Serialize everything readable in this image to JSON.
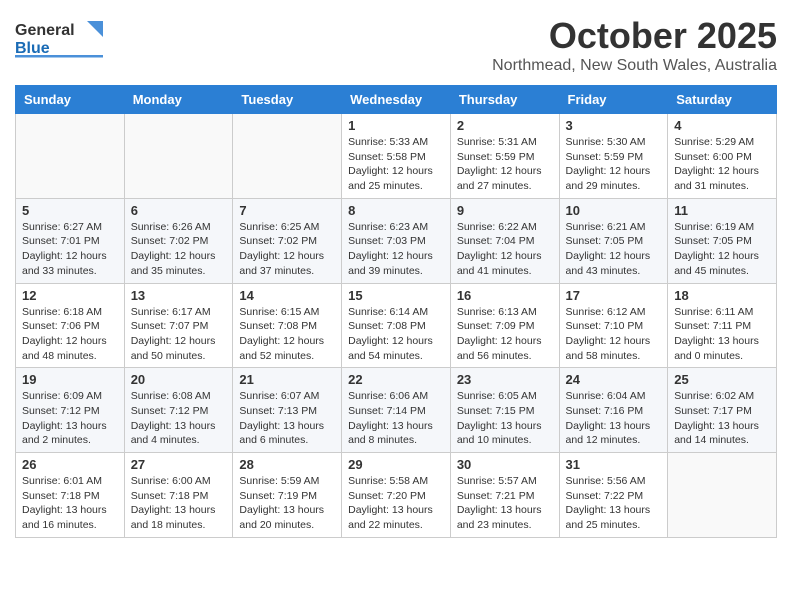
{
  "header": {
    "logo_general": "General",
    "logo_blue": "Blue",
    "month": "October 2025",
    "location": "Northmead, New South Wales, Australia"
  },
  "weekdays": [
    "Sunday",
    "Monday",
    "Tuesday",
    "Wednesday",
    "Thursday",
    "Friday",
    "Saturday"
  ],
  "weeks": [
    [
      {
        "day": "",
        "sunrise": "",
        "sunset": "",
        "daylight": ""
      },
      {
        "day": "",
        "sunrise": "",
        "sunset": "",
        "daylight": ""
      },
      {
        "day": "",
        "sunrise": "",
        "sunset": "",
        "daylight": ""
      },
      {
        "day": "1",
        "sunrise": "Sunrise: 5:33 AM",
        "sunset": "Sunset: 5:58 PM",
        "daylight": "Daylight: 12 hours and 25 minutes."
      },
      {
        "day": "2",
        "sunrise": "Sunrise: 5:31 AM",
        "sunset": "Sunset: 5:59 PM",
        "daylight": "Daylight: 12 hours and 27 minutes."
      },
      {
        "day": "3",
        "sunrise": "Sunrise: 5:30 AM",
        "sunset": "Sunset: 5:59 PM",
        "daylight": "Daylight: 12 hours and 29 minutes."
      },
      {
        "day": "4",
        "sunrise": "Sunrise: 5:29 AM",
        "sunset": "Sunset: 6:00 PM",
        "daylight": "Daylight: 12 hours and 31 minutes."
      }
    ],
    [
      {
        "day": "5",
        "sunrise": "Sunrise: 6:27 AM",
        "sunset": "Sunset: 7:01 PM",
        "daylight": "Daylight: 12 hours and 33 minutes."
      },
      {
        "day": "6",
        "sunrise": "Sunrise: 6:26 AM",
        "sunset": "Sunset: 7:02 PM",
        "daylight": "Daylight: 12 hours and 35 minutes."
      },
      {
        "day": "7",
        "sunrise": "Sunrise: 6:25 AM",
        "sunset": "Sunset: 7:02 PM",
        "daylight": "Daylight: 12 hours and 37 minutes."
      },
      {
        "day": "8",
        "sunrise": "Sunrise: 6:23 AM",
        "sunset": "Sunset: 7:03 PM",
        "daylight": "Daylight: 12 hours and 39 minutes."
      },
      {
        "day": "9",
        "sunrise": "Sunrise: 6:22 AM",
        "sunset": "Sunset: 7:04 PM",
        "daylight": "Daylight: 12 hours and 41 minutes."
      },
      {
        "day": "10",
        "sunrise": "Sunrise: 6:21 AM",
        "sunset": "Sunset: 7:05 PM",
        "daylight": "Daylight: 12 hours and 43 minutes."
      },
      {
        "day": "11",
        "sunrise": "Sunrise: 6:19 AM",
        "sunset": "Sunset: 7:05 PM",
        "daylight": "Daylight: 12 hours and 45 minutes."
      }
    ],
    [
      {
        "day": "12",
        "sunrise": "Sunrise: 6:18 AM",
        "sunset": "Sunset: 7:06 PM",
        "daylight": "Daylight: 12 hours and 48 minutes."
      },
      {
        "day": "13",
        "sunrise": "Sunrise: 6:17 AM",
        "sunset": "Sunset: 7:07 PM",
        "daylight": "Daylight: 12 hours and 50 minutes."
      },
      {
        "day": "14",
        "sunrise": "Sunrise: 6:15 AM",
        "sunset": "Sunset: 7:08 PM",
        "daylight": "Daylight: 12 hours and 52 minutes."
      },
      {
        "day": "15",
        "sunrise": "Sunrise: 6:14 AM",
        "sunset": "Sunset: 7:08 PM",
        "daylight": "Daylight: 12 hours and 54 minutes."
      },
      {
        "day": "16",
        "sunrise": "Sunrise: 6:13 AM",
        "sunset": "Sunset: 7:09 PM",
        "daylight": "Daylight: 12 hours and 56 minutes."
      },
      {
        "day": "17",
        "sunrise": "Sunrise: 6:12 AM",
        "sunset": "Sunset: 7:10 PM",
        "daylight": "Daylight: 12 hours and 58 minutes."
      },
      {
        "day": "18",
        "sunrise": "Sunrise: 6:11 AM",
        "sunset": "Sunset: 7:11 PM",
        "daylight": "Daylight: 13 hours and 0 minutes."
      }
    ],
    [
      {
        "day": "19",
        "sunrise": "Sunrise: 6:09 AM",
        "sunset": "Sunset: 7:12 PM",
        "daylight": "Daylight: 13 hours and 2 minutes."
      },
      {
        "day": "20",
        "sunrise": "Sunrise: 6:08 AM",
        "sunset": "Sunset: 7:12 PM",
        "daylight": "Daylight: 13 hours and 4 minutes."
      },
      {
        "day": "21",
        "sunrise": "Sunrise: 6:07 AM",
        "sunset": "Sunset: 7:13 PM",
        "daylight": "Daylight: 13 hours and 6 minutes."
      },
      {
        "day": "22",
        "sunrise": "Sunrise: 6:06 AM",
        "sunset": "Sunset: 7:14 PM",
        "daylight": "Daylight: 13 hours and 8 minutes."
      },
      {
        "day": "23",
        "sunrise": "Sunrise: 6:05 AM",
        "sunset": "Sunset: 7:15 PM",
        "daylight": "Daylight: 13 hours and 10 minutes."
      },
      {
        "day": "24",
        "sunrise": "Sunrise: 6:04 AM",
        "sunset": "Sunset: 7:16 PM",
        "daylight": "Daylight: 13 hours and 12 minutes."
      },
      {
        "day": "25",
        "sunrise": "Sunrise: 6:02 AM",
        "sunset": "Sunset: 7:17 PM",
        "daylight": "Daylight: 13 hours and 14 minutes."
      }
    ],
    [
      {
        "day": "26",
        "sunrise": "Sunrise: 6:01 AM",
        "sunset": "Sunset: 7:18 PM",
        "daylight": "Daylight: 13 hours and 16 minutes."
      },
      {
        "day": "27",
        "sunrise": "Sunrise: 6:00 AM",
        "sunset": "Sunset: 7:18 PM",
        "daylight": "Daylight: 13 hours and 18 minutes."
      },
      {
        "day": "28",
        "sunrise": "Sunrise: 5:59 AM",
        "sunset": "Sunset: 7:19 PM",
        "daylight": "Daylight: 13 hours and 20 minutes."
      },
      {
        "day": "29",
        "sunrise": "Sunrise: 5:58 AM",
        "sunset": "Sunset: 7:20 PM",
        "daylight": "Daylight: 13 hours and 22 minutes."
      },
      {
        "day": "30",
        "sunrise": "Sunrise: 5:57 AM",
        "sunset": "Sunset: 7:21 PM",
        "daylight": "Daylight: 13 hours and 23 minutes."
      },
      {
        "day": "31",
        "sunrise": "Sunrise: 5:56 AM",
        "sunset": "Sunset: 7:22 PM",
        "daylight": "Daylight: 13 hours and 25 minutes."
      },
      {
        "day": "",
        "sunrise": "",
        "sunset": "",
        "daylight": ""
      }
    ]
  ]
}
